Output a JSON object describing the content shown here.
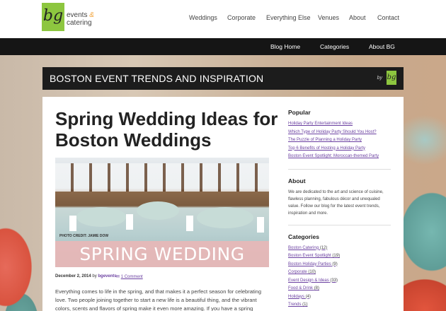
{
  "header": {
    "logo_mark": "bg",
    "logo_line1": "events",
    "logo_amp": "&",
    "logo_line2": "catering",
    "nav": [
      "Weddings",
      "Corporate",
      "Everything Else",
      "Venues",
      "About",
      "Contact"
    ]
  },
  "blog_nav": [
    "Blog Home",
    "Categories",
    "About BG"
  ],
  "banner": {
    "title": "BOSTON EVENT TRENDS AND INSPIRATION",
    "by": "by",
    "mini_logo": "bg"
  },
  "post": {
    "title": "Spring Wedding Ideas for Boston Weddings",
    "image_credit": "PHOTO CREDIT: JAMIE DOW",
    "image_banner": "SPRING WEDDING IDEAS",
    "date": "December 2, 2014",
    "by_label": "by",
    "author": "bgevents",
    "comments": "1 Comment",
    "excerpt": "Everything comes to life in the spring, and that makes it a perfect season for celebrating love. Two people joining together to start a new life is a beautiful thing, and the vibrant colors, scents and flavors of spring make it even more amazing. If you have a spring"
  },
  "sidebar": {
    "popular_heading": "Popular",
    "popular": [
      "Holiday Party Entertainment Ideas",
      "Which Type of Holiday Party Should You Host?",
      "The Puzzle of Planning a Holiday Party",
      "Top 6 Benefits of Hosting a Holiday Party",
      "Boston Event Spotlight: Moroccan-themed Party"
    ],
    "about_heading": "About",
    "about_text": "We are dedicated to the art and science of cuisine, flawless planning, fabulous décor and unequaled value. Follow our blog for the latest event trends, inspiration and more.",
    "categories_heading": "Categories",
    "categories": [
      {
        "name": "Boston Catering",
        "count": "(12)"
      },
      {
        "name": "Boston Event Spotlight",
        "count": "(19)"
      },
      {
        "name": "Boston Holiday Parties",
        "count": "(9)"
      },
      {
        "name": "Corporate",
        "count": "(10)"
      },
      {
        "name": "Event Design & Ideas",
        "count": "(33)"
      },
      {
        "name": "Food & Drink",
        "count": "(8)"
      },
      {
        "name": "Holidays",
        "count": "(4)"
      },
      {
        "name": "Trends",
        "count": "(1)"
      }
    ]
  }
}
